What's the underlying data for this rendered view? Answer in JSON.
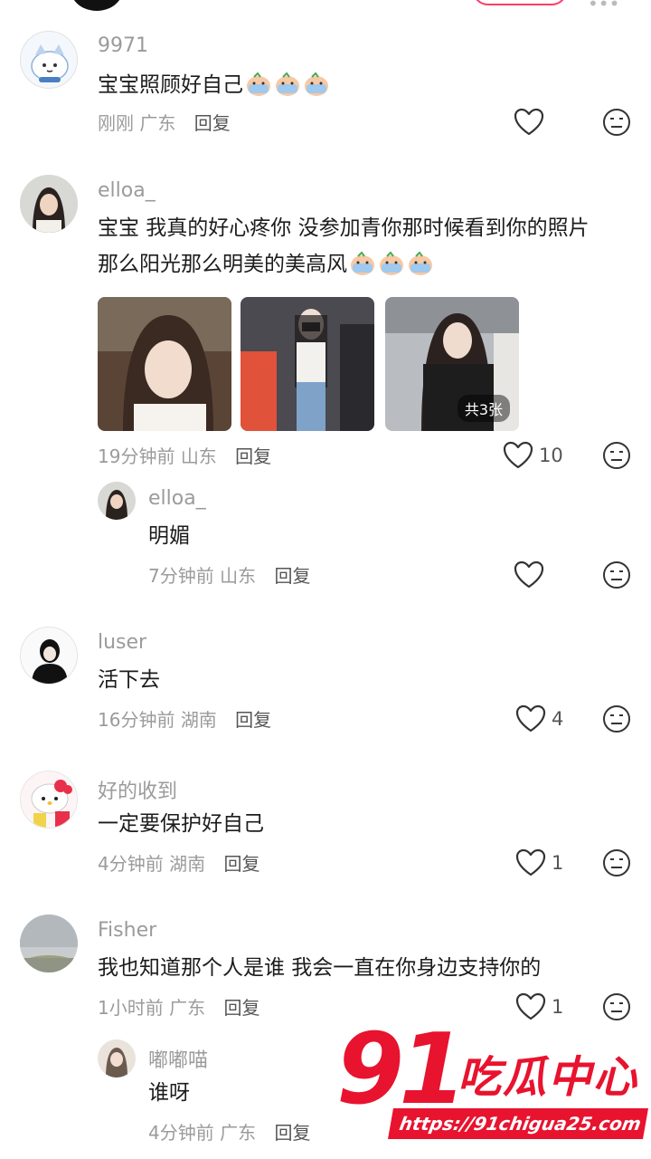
{
  "colors": {
    "accent": "#ff3b66",
    "meta": "#9b9b9b",
    "watermark": "#e8132e"
  },
  "comments": [
    {
      "name": "9971",
      "text": "宝宝照顾好自己",
      "emoji_count": 3,
      "time": "刚刚",
      "location": "广东",
      "reply": "回复",
      "likes": ""
    },
    {
      "name": "elloa_",
      "text_line1": "宝宝 我真的好心疼你 没参加青你那时候看到你的照片",
      "text_line2": "那么阳光那么明美的美高风",
      "emoji_count": 3,
      "photos_badge": "共3张",
      "time": "19分钟前",
      "location": "山东",
      "reply": "回复",
      "likes": "10",
      "sub_reply": {
        "name": "elloa_",
        "text": "明媚",
        "time": "7分钟前",
        "location": "山东",
        "reply": "回复",
        "likes": ""
      }
    },
    {
      "name": "luser",
      "text": "活下去",
      "time": "16分钟前",
      "location": "湖南",
      "reply": "回复",
      "likes": "4"
    },
    {
      "name": "好的收到",
      "text": "一定要保护好自己",
      "time": "4分钟前",
      "location": "湖南",
      "reply": "回复",
      "likes": "1"
    },
    {
      "name": "Fisher",
      "text": "我也知道那个人是谁 我会一直在你身边支持你的",
      "time": "1小时前",
      "location": "广东",
      "reply": "回复",
      "likes": "1",
      "sub_reply": {
        "name": "嘟嘟喵",
        "text": "谁呀",
        "time": "4分钟前",
        "location": "广东",
        "reply": "回复"
      }
    }
  ],
  "icons": {
    "like": "heart-outline-icon",
    "dislike": "neutral-face-icon",
    "emoji": "crying-emoji-icon"
  },
  "watermark": {
    "number": "91",
    "text": "吃瓜中心",
    "url": "https://91chigua25.com"
  }
}
